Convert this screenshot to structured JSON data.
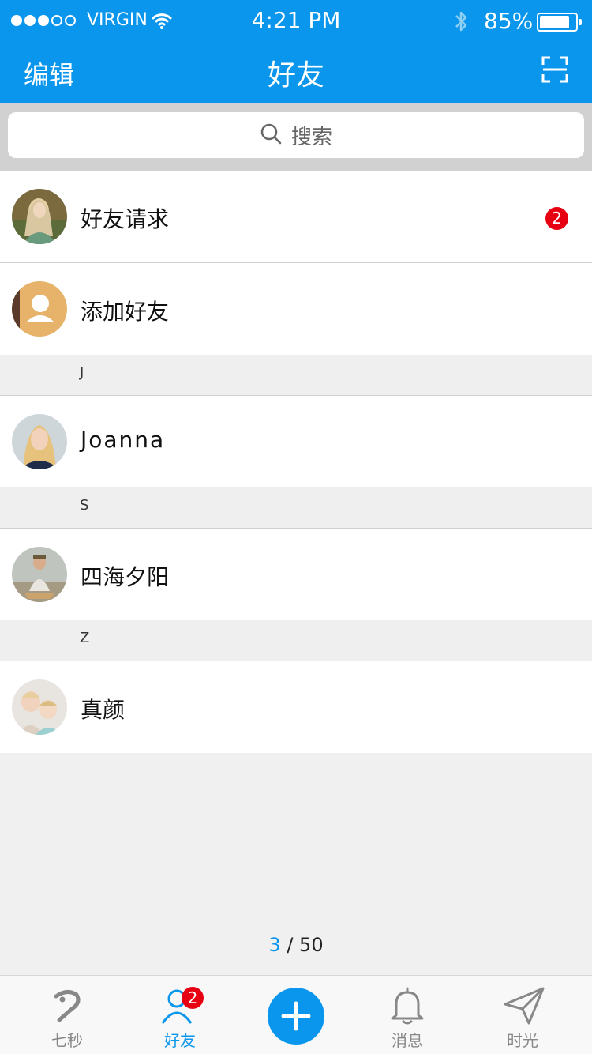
{
  "status_bar": {
    "carrier": "VIRGIN",
    "time": "4:21 PM",
    "battery": "85%",
    "battery_level": 0.85
  },
  "nav": {
    "edit_label": "编辑",
    "title": "好友",
    "scan_icon": "scan-icon"
  },
  "search": {
    "placeholder": "搜索"
  },
  "list": {
    "friend_requests": {
      "label": "好友请求",
      "badge": "2"
    },
    "add_friend": {
      "label": "添加好友"
    },
    "sections": [
      {
        "letter": "J",
        "items": [
          {
            "name": "Joanna"
          }
        ]
      },
      {
        "letter": "S",
        "items": [
          {
            "name": "四海夕阳"
          }
        ]
      },
      {
        "letter": "Z",
        "items": [
          {
            "name": "真颜"
          }
        ]
      }
    ]
  },
  "pager": {
    "current": "3",
    "separator": "/",
    "total": "50"
  },
  "tab_bar": {
    "tabs": [
      {
        "label": "七秒",
        "icon": "seven-icon"
      },
      {
        "label": "好友",
        "icon": "person-icon",
        "badge": "2",
        "active": true
      },
      {
        "label": "",
        "icon": "plus-icon"
      },
      {
        "label": "消息",
        "icon": "bell-icon"
      },
      {
        "label": "时光",
        "icon": "paper-plane-icon"
      }
    ]
  },
  "colors": {
    "accent": "#0a96ec",
    "badge": "#e60012",
    "background": "#f0f0f0"
  }
}
